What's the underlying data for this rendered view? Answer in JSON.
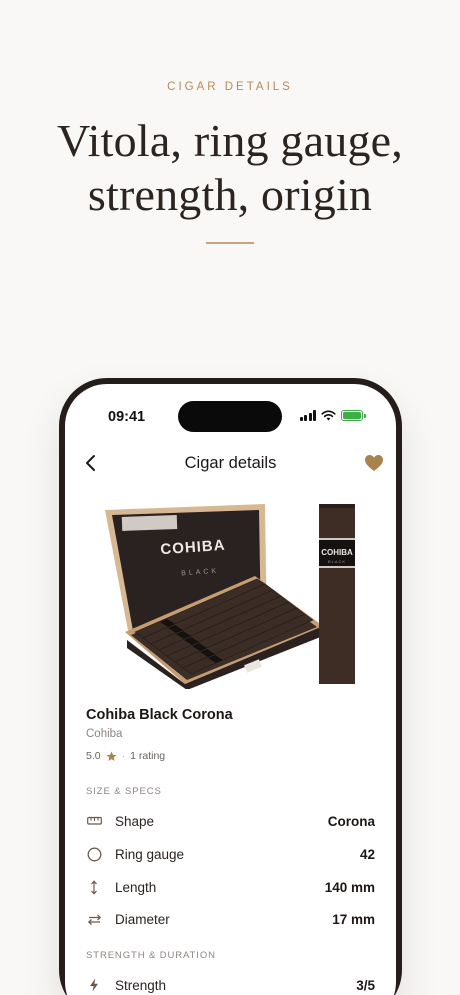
{
  "marketing": {
    "eyebrow": "CIGAR DETAILS",
    "headline_line1": "Vitola, ring gauge,",
    "headline_line2": "strength, origin"
  },
  "status_bar": {
    "time": "09:41"
  },
  "nav": {
    "title": "Cigar details",
    "back_icon": "chevron-left-icon",
    "favorite_icon": "heart-icon"
  },
  "cigar": {
    "name": "Cohiba Black Corona",
    "brand": "Cohiba",
    "rating": "5.0",
    "rating_separator": "·",
    "rating_count": "1 rating",
    "box_brand": "COHIBA",
    "box_line": "BLACK"
  },
  "size_specs": {
    "label": "SIZE & SPECS",
    "rows": [
      {
        "icon": "ruler-icon",
        "label": "Shape",
        "value": "Corona"
      },
      {
        "icon": "circle-icon",
        "label": "Ring gauge",
        "value": "42"
      },
      {
        "icon": "vertical-arrows-icon",
        "label": "Length",
        "value": "140 mm"
      },
      {
        "icon": "horizontal-arrows-icon",
        "label": "Diameter",
        "value": "17 mm"
      }
    ]
  },
  "strength_duration": {
    "label": "STRENGTH & DURATION",
    "rows": [
      {
        "icon": "bolt-icon",
        "label": "Strength",
        "value": "3/5"
      }
    ]
  },
  "colors": {
    "accent": "#b78a55",
    "heart": "#a8834f",
    "star": "#a8834f",
    "battery": "#3fae4a"
  }
}
